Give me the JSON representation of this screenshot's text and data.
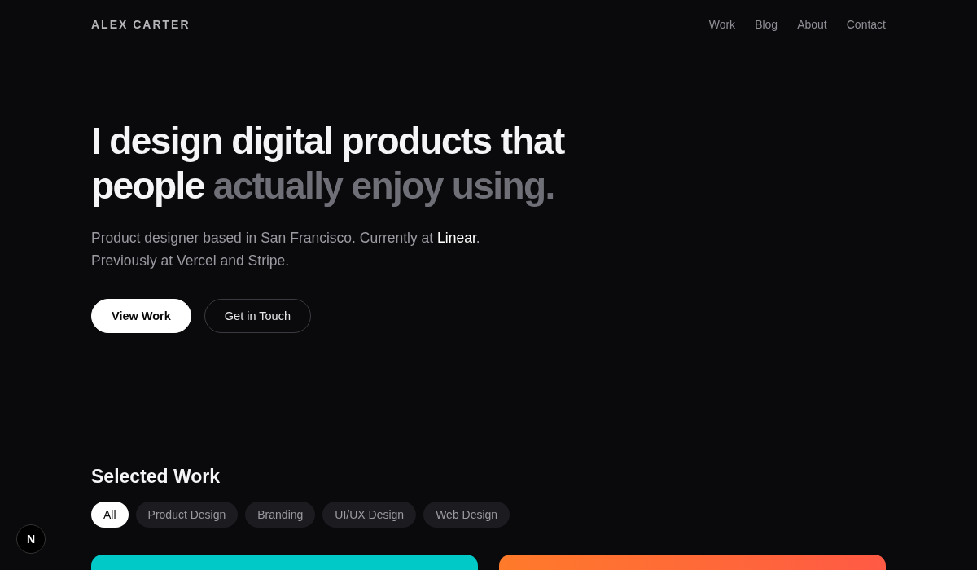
{
  "header": {
    "brand": "ALEX CARTER",
    "nav": [
      {
        "label": "Work"
      },
      {
        "label": "Blog"
      },
      {
        "label": "About"
      },
      {
        "label": "Contact"
      }
    ]
  },
  "hero": {
    "headline": "I design digital products that people",
    "headline_muted": "actually enjoy using.",
    "intro": "Product designer based in San Francisco. Currently at",
    "company": "Linear",
    "intro_end": ".",
    "previously": "Previously at Vercel and Stripe.",
    "buttons": [
      {
        "label": "View Work",
        "kind": "primary"
      },
      {
        "label": "Get in Touch",
        "kind": "secondary"
      }
    ]
  },
  "work": {
    "title": "Selected Work",
    "filters": [
      {
        "label": "All",
        "selected": true
      },
      {
        "label": "Product Design",
        "selected": false
      },
      {
        "label": "Branding",
        "selected": false
      },
      {
        "label": "UI/UX Design",
        "selected": false
      },
      {
        "label": "Web Design",
        "selected": false
      }
    ]
  },
  "dev_indicator": {
    "label": "N"
  }
}
